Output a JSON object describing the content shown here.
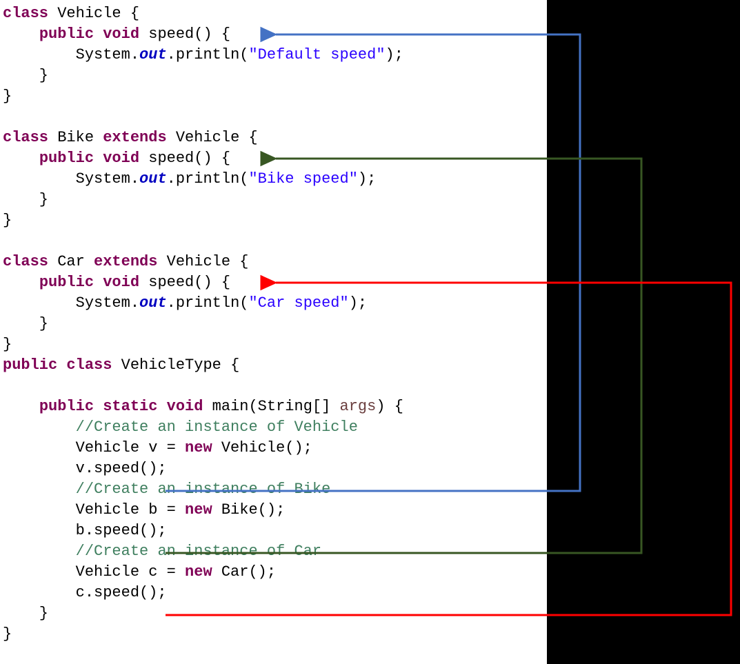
{
  "code": {
    "l1a": "class",
    "l1b": " Vehicle {",
    "l2a": "    ",
    "l2b": "public",
    "l2c": " ",
    "l2d": "void",
    "l2e": " speed() {",
    "l3a": "        System.",
    "l3b": "out",
    "l3c": ".println(",
    "l3d": "\"Default speed\"",
    "l3e": ");",
    "l4": "    }",
    "l5": "}",
    "blank": "",
    "l7a": "class",
    "l7b": " Bike ",
    "l7c": "extends",
    "l7d": " Vehicle {",
    "l8a": "    ",
    "l8b": "public",
    "l8c": " ",
    "l8d": "void",
    "l8e": " speed() {",
    "l9a": "        System.",
    "l9b": "out",
    "l9c": ".println(",
    "l9d": "\"Bike speed\"",
    "l9e": ");",
    "l10": "    }",
    "l11": "}",
    "l13a": "class",
    "l13b": " Car ",
    "l13c": "extends",
    "l13d": " Vehicle {",
    "l14a": "    ",
    "l14b": "public",
    "l14c": " ",
    "l14d": "void",
    "l14e": " speed() {",
    "l15a": "        System.",
    "l15b": "out",
    "l15c": ".println(",
    "l15d": "\"Car speed\"",
    "l15e": ");",
    "l16": "    }",
    "l17": "}",
    "l18a": "public",
    "l18b": " ",
    "l18c": "class",
    "l18d": " VehicleType {",
    "l20a": "    ",
    "l20b": "public",
    "l20c": " ",
    "l20d": "static",
    "l20e": " ",
    "l20f": "void",
    "l20g": " main(String[] ",
    "l20h": "args",
    "l20i": ") {",
    "l21a": "        ",
    "l21b": "//Create an instance of Vehicle",
    "l22a": "        Vehicle v = ",
    "l22b": "new",
    "l22c": " Vehicle();",
    "l23": "        v.speed();",
    "l24a": "        ",
    "l24b": "//Create an instance of Bike",
    "l25a": "        Vehicle b = ",
    "l25b": "new",
    "l25c": " Bike();",
    "l26": "        b.speed();",
    "l27a": "        ",
    "l27b": "//Create an instance of Car",
    "l28a": "        Vehicle c = ",
    "l28b": "new",
    "l28c": " Car();",
    "l29": "        c.speed();",
    "l30": "    }",
    "l31": "}"
  },
  "arrows": {
    "blue": {
      "color": "#4472c4",
      "from_desc": "v.speed()",
      "to_desc": "Vehicle.speed()"
    },
    "green": {
      "color": "#385723",
      "from_desc": "b.speed()",
      "to_desc": "Bike.speed()"
    },
    "red": {
      "color": "#ff0000",
      "from_desc": "c.speed()",
      "to_desc": "Car.speed()"
    }
  }
}
